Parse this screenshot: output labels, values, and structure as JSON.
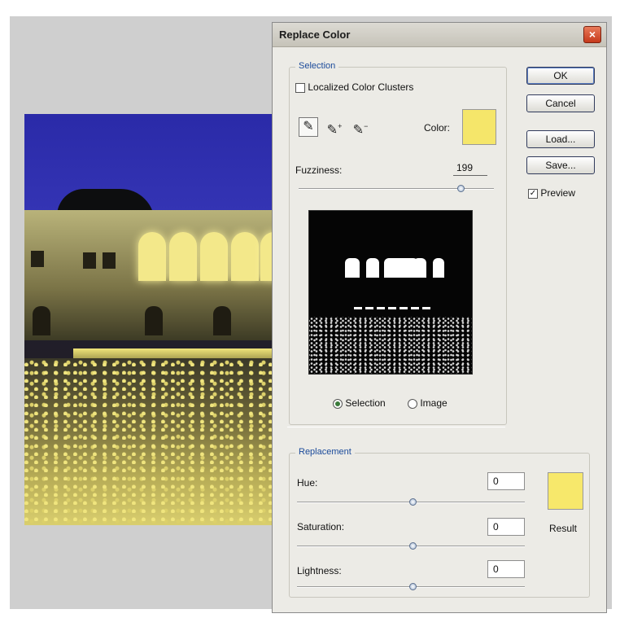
{
  "dialog": {
    "title": "Replace Color",
    "close_glyph": "×",
    "buttons": {
      "ok": "OK",
      "cancel": "Cancel",
      "load": "Load...",
      "save": "Save..."
    },
    "preview_label": "Preview",
    "preview_checked": true
  },
  "selection": {
    "group_label": "Selection",
    "localized_label": "Localized Color Clusters",
    "localized_checked": false,
    "eyedroppers": [
      "eyedropper-icon",
      "eyedropper-plus-icon",
      "eyedropper-minus-icon"
    ],
    "color_label": "Color:",
    "color_hex": "#f5e66a",
    "fuzziness_label": "Fuzziness:",
    "fuzziness_value": "199",
    "fuzziness_fraction": 0.83,
    "view_options": [
      "Selection",
      "Image"
    ],
    "view_selected": "Selection"
  },
  "replacement": {
    "group_label": "Replacement",
    "hue_label": "Hue:",
    "hue_value": "0",
    "saturation_label": "Saturation:",
    "saturation_value": "0",
    "lightness_label": "Lightness:",
    "lightness_value": "0",
    "result_label": "Result",
    "result_hex": "#f7e86b"
  }
}
